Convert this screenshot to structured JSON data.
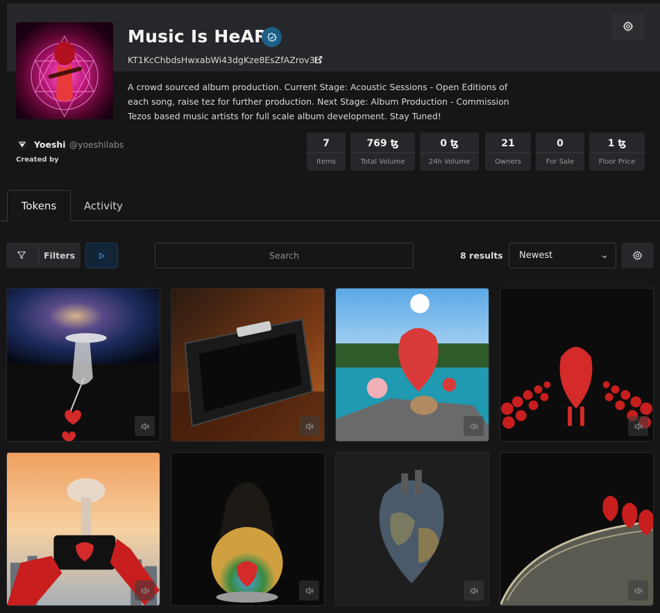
{
  "collection": {
    "title": "Music Is HeART",
    "address": "KT1KcChbdsHwxabWi43dgKze8EsZfAZrov3H",
    "description": "A crowd sourced album production. Current Stage: Acoustic Sessions - Open Editions of each song, raise tez for further production. Next Stage: Album Production - Commission Tezos based music artists for full scale album development. Stay Tuned!",
    "verified_icon": "verified-badge-icon",
    "external_link_icon": "external-link-icon"
  },
  "creator": {
    "name": "Yoeshi",
    "handle": "@yoeshilabs",
    "created_by_label": "Created by"
  },
  "stats": [
    {
      "value": "7",
      "label": "Items"
    },
    {
      "value": "769 ꜩ",
      "label": "Total Volume"
    },
    {
      "value": "0 ꜩ",
      "label": "24h Volume"
    },
    {
      "value": "21",
      "label": "Owners"
    },
    {
      "value": "0",
      "label": "For Sale"
    },
    {
      "value": "1 ꜩ",
      "label": "Floor Price"
    }
  ],
  "tabs": [
    {
      "label": "Tokens",
      "active": true
    },
    {
      "label": "Activity",
      "active": false
    }
  ],
  "toolbar": {
    "filters_label": "Filters",
    "search_placeholder": "Search",
    "results_text": "8 results",
    "sort_value": "Newest"
  },
  "tokens": [
    {
      "art": "space-heart-keyhole",
      "icon": "speaker-icon"
    },
    {
      "art": "speaker-no-hurry",
      "icon": "speaker-icon"
    },
    {
      "art": "heart-on-river-rock",
      "icon": "speaker-icon"
    },
    {
      "art": "heart-walking-roses",
      "icon": "speaker-icon"
    },
    {
      "art": "phone-mushroom-cloud",
      "icon": "speaker-icon"
    },
    {
      "art": "hooded-figure-globe",
      "icon": "speaker-icon"
    },
    {
      "art": "earth-heart",
      "icon": "speaker-icon"
    },
    {
      "art": "hearts-rollercoaster",
      "icon": "speaker-icon"
    }
  ],
  "colors": {
    "background": "#161617",
    "panel": "#26272a",
    "accent_blue": "#1d5f86",
    "heart_red": "#d42a2a"
  }
}
